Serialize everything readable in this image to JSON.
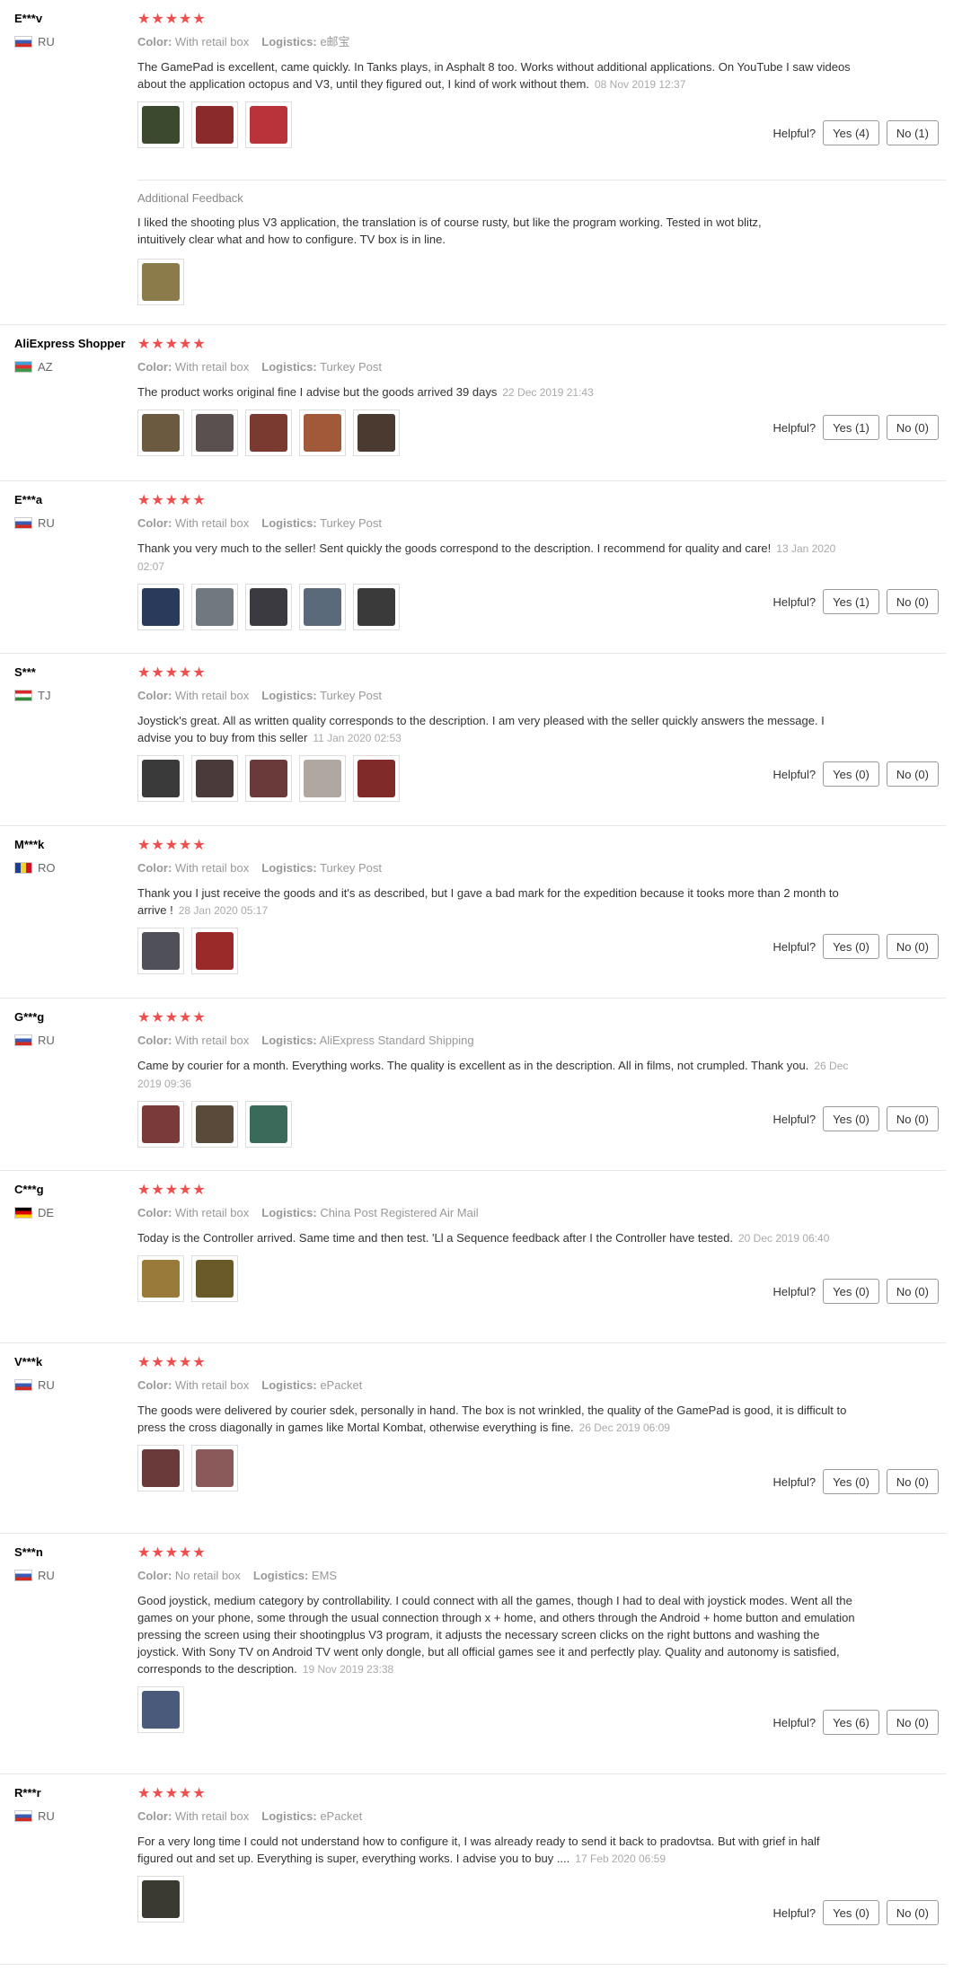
{
  "ui": {
    "color_label": "Color:",
    "logistics_label": "Logistics:",
    "helpful_label": "Helpful?",
    "star_glyphs": "★★★★★",
    "additional_feedback_label": "Additional Feedback"
  },
  "reviews": [
    {
      "user": "E***v",
      "country": "RU",
      "flag": "ru",
      "stars": 5,
      "color": "With retail box",
      "logistics": "e邮宝",
      "text": "The GamePad is excellent, came quickly. In Tanks plays, in Asphalt 8 too. Works without additional applications. On YouTube I saw videos about the application octopus and V3, until they figured out, I kind of work without them.",
      "date": "08 Nov 2019 12:37",
      "photos": [
        "#3b4a2e",
        "#8a2a2a",
        "#b8343a"
      ],
      "yes": "Yes (4)",
      "no": "No (1)",
      "additional": {
        "text": "I liked the shooting plus V3 application, the translation is of course rusty, but like the program working. Tested in wot blitz, intuitively clear what and how to configure. TV box is in line.",
        "photos": [
          "#8b7a4a"
        ]
      }
    },
    {
      "user": "AliExpress Shopper",
      "country": "AZ",
      "flag": "az",
      "stars": 5,
      "color": "With retail box",
      "logistics": "Turkey Post",
      "text": "The product works original fine I advise but the goods arrived 39 days",
      "date": "22 Dec 2019 21:43",
      "photos": [
        "#6b5a40",
        "#5a5050",
        "#7a3a30",
        "#a05a3a",
        "#4a3a30"
      ],
      "yes": "Yes (1)",
      "no": "No (0)"
    },
    {
      "user": "E***a",
      "country": "RU",
      "flag": "ru",
      "stars": 5,
      "color": "With retail box",
      "logistics": "Turkey Post",
      "text": "Thank you very much to the seller! Sent quickly the goods correspond to the description. I recommend for quality and care!",
      "date": "13 Jan 2020 02:07",
      "photos": [
        "#2a3a5a",
        "#707880",
        "#3a3a40",
        "#5a6a7a",
        "#3a3a3a"
      ],
      "yes": "Yes (1)",
      "no": "No (0)"
    },
    {
      "user": "S***",
      "country": "TJ",
      "flag": "tj",
      "stars": 5,
      "color": "With retail box",
      "logistics": "Turkey Post",
      "text": "Joystick's great. All as written quality corresponds to the description. I am very pleased with the seller quickly answers the message. I advise you to buy from this seller",
      "date": "11 Jan 2020 02:53",
      "photos": [
        "#3a3a3a",
        "#4a3a3a",
        "#6a3a3a",
        "#b0a8a0",
        "#802a2a"
      ],
      "yes": "Yes (0)",
      "no": "No (0)"
    },
    {
      "user": "M***k",
      "country": "RO",
      "flag": "ro",
      "stars": 5,
      "color": "With retail box",
      "logistics": "Turkey Post",
      "text": "Thank you I just receive the goods and it's as described, but I gave a bad mark for the expedition because it tooks more than 2 month to arrive !",
      "date": "28 Jan 2020 05:17",
      "photos": [
        "#505058",
        "#9a2a2a"
      ],
      "yes": "Yes (0)",
      "no": "No (0)"
    },
    {
      "user": "G***g",
      "country": "RU",
      "flag": "ru",
      "stars": 5,
      "color": "With retail box",
      "logistics": "AliExpress Standard Shipping",
      "text": "Came by courier for a month. Everything works. The quality is excellent as in the description. All in films, not crumpled. Thank you.",
      "date": "26 Dec 2019 09:36",
      "photos": [
        "#7a3a3a",
        "#5a4a3a",
        "#3a6a5a"
      ],
      "yes": "Yes (0)",
      "no": "No (0)"
    },
    {
      "user": "C***g",
      "country": "DE",
      "flag": "de",
      "stars": 5,
      "color": "With retail box",
      "logistics": "China Post Registered Air Mail",
      "text": "Today is the Controller arrived. Same time and then test. 'Ll a Sequence feedback after I the Controller have tested.",
      "date": "20 Dec 2019 06:40",
      "photos": [
        "#9a7a3a",
        "#6a5a2a"
      ],
      "yes": "Yes (0)",
      "no": "No (0)"
    },
    {
      "user": "V***k",
      "country": "RU",
      "flag": "ru",
      "stars": 5,
      "color": "With retail box",
      "logistics": "ePacket",
      "text": "The goods were delivered by courier sdek, personally in hand. The box is not wrinkled, the quality of the GamePad is good, it is difficult to press the cross diagonally in games like Mortal Kombat, otherwise everything is fine.",
      "date": "26 Dec 2019 06:09",
      "photos": [
        "#6a3a3a",
        "#8a5a5a"
      ],
      "yes": "Yes (0)",
      "no": "No (0)"
    },
    {
      "user": "S***n",
      "country": "RU",
      "flag": "ru",
      "stars": 5,
      "color": "No retail box",
      "logistics": "EMS",
      "text": "Good joystick, medium category by controllability. I could connect with all the games, though I had to deal with joystick modes. Went all the games on your phone, some through the usual connection through x + home, and others through the Android + home button and emulation pressing the screen using their shootingplus V3 program, it adjusts the necessary screen clicks on the right buttons and washing the joystick. With Sony TV on Android TV went only dongle, but all official games see it and perfectly play. Quality and autonomy is satisfied, corresponds to the description.",
      "date": "19 Nov 2019 23:38",
      "photos": [
        "#4a5a7a"
      ],
      "yes": "Yes (6)",
      "no": "No (0)"
    },
    {
      "user": "R***r",
      "country": "RU",
      "flag": "ru",
      "stars": 5,
      "color": "With retail box",
      "logistics": "ePacket",
      "text": "For a very long time I could not understand how to configure it, I was already ready to send it back to pradovtsa. But with grief in half figured out and set up. Everything is super, everything works. I advise you to buy ....",
      "date": "17 Feb 2020 06:59",
      "photos": [
        "#3a3a30"
      ],
      "yes": "Yes (0)",
      "no": "No (0)"
    }
  ]
}
